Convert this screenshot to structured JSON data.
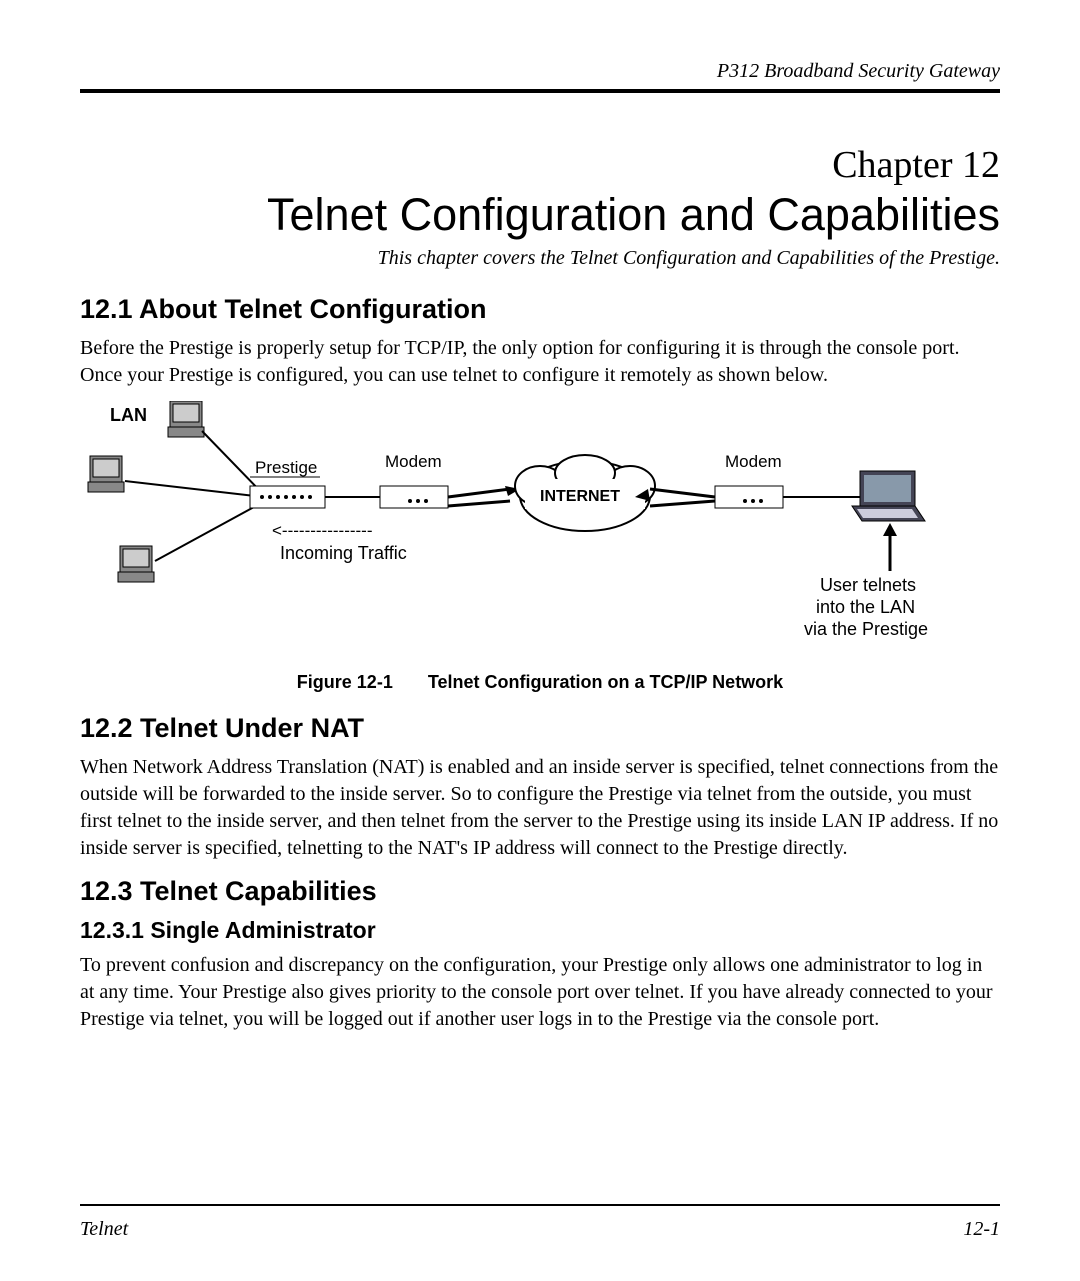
{
  "header": {
    "product": "P312  Broadband Security Gateway"
  },
  "chapter": {
    "label": "Chapter 12",
    "title": "Telnet Configuration and Capabilities",
    "subtitle": "This chapter covers the Telnet Configuration and Capabilities of the Prestige."
  },
  "sections": {
    "s1": {
      "heading": "12.1   About Telnet Configuration",
      "body": "Before the Prestige is properly setup for TCP/IP, the only option for configuring it is through the console port. Once your Prestige is configured, you can use telnet to configure it remotely as shown below."
    },
    "figure": {
      "caption_prefix": "Figure 12-1",
      "caption_text": "Telnet Configuration on a TCP/IP Network",
      "labels": {
        "lan": "LAN",
        "prestige": "Prestige",
        "modem_left": "Modem",
        "modem_right": "Modem",
        "internet": "INTERNET",
        "incoming_arrow": "<----------------",
        "incoming": "Incoming Traffic",
        "user1": "User telnets",
        "user2": "into the LAN",
        "user3": "via the Prestige"
      }
    },
    "s2": {
      "heading": "12.2  Telnet Under NAT",
      "body": "When Network Address Translation (NAT) is enabled and an inside server is specified, telnet connections from the outside will be forwarded to the inside server. So to configure the Prestige via telnet from the outside, you must first telnet to the inside server, and then telnet from the server to the Prestige using its inside LAN IP address. If no inside server is specified, telnetting to the NAT's IP address will connect to the Prestige directly."
    },
    "s3": {
      "heading": "12.3   Telnet Capabilities",
      "sub1_heading": "12.3.1 Single Administrator",
      "sub1_body": "To prevent confusion and discrepancy on the configuration, your Prestige only allows one administrator to log in at any time. Your Prestige also gives priority to the console port over telnet. If you have already connected to your Prestige via telnet, you will be logged out if another user logs in to the Prestige via the console port."
    }
  },
  "footer": {
    "left": "Telnet",
    "right": "12-1"
  }
}
